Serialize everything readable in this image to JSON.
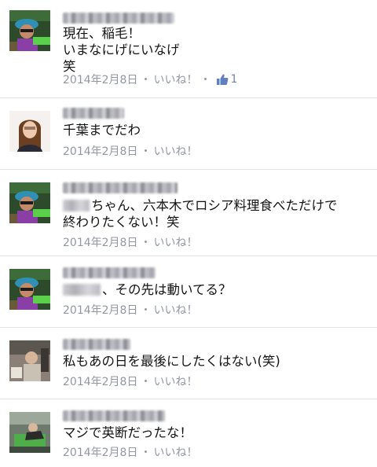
{
  "comments": [
    {
      "lines": "現在、稲毛！\nいまなにげにいなげ\n笑",
      "date": "2014年2月8日",
      "like_label": "いいね！",
      "separator": "・",
      "like_count": "1"
    },
    {
      "lines": "千葉までだわ",
      "date": "2014年2月8日",
      "like_label": "いいね！",
      "separator": "・"
    },
    {
      "lines": "ちゃん、六本木でロシア料理食べただけで\n終わりたくない！笑",
      "date": "2014年2月8日",
      "like_label": "いいね！",
      "separator": "・"
    },
    {
      "lines": "、その先は動いてる？",
      "date": "2014年2月8日",
      "like_label": "いいね！",
      "separator": "・"
    },
    {
      "lines": "私もあの日を最後にしたくはない(笑)",
      "date": "2014年2月8日",
      "like_label": "いいね！",
      "separator": "・"
    },
    {
      "lines": "マジで英断だったな！",
      "date": "2014年2月8日",
      "like_label": "いいね！",
      "separator": "・"
    }
  ],
  "colors": {
    "meta_text": "#9197a3",
    "like_blue": "#6d84b4",
    "divider": "#e3e3e6"
  },
  "icons": [
    "thumbs-up-icon"
  ]
}
